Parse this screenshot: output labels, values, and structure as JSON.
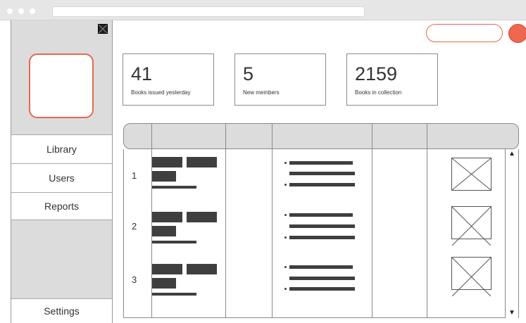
{
  "sidebar": {
    "items": [
      {
        "label": "Library"
      },
      {
        "label": "Users"
      },
      {
        "label": "Reports"
      }
    ],
    "settings_label": "Settings"
  },
  "stats": [
    {
      "value": "41",
      "label": "Books issued yesterday"
    },
    {
      "value": "5",
      "label": "New members"
    },
    {
      "value": "2159",
      "label": "Books in collection"
    }
  ],
  "table": {
    "rows": [
      {
        "index": "1"
      },
      {
        "index": "2"
      },
      {
        "index": "3"
      }
    ]
  },
  "scroll": {
    "up": "▲",
    "down": "▼"
  },
  "colors": {
    "accent": "#e8674e",
    "placeholder": "#3f3f3f",
    "panel": "#dcdcdc"
  }
}
